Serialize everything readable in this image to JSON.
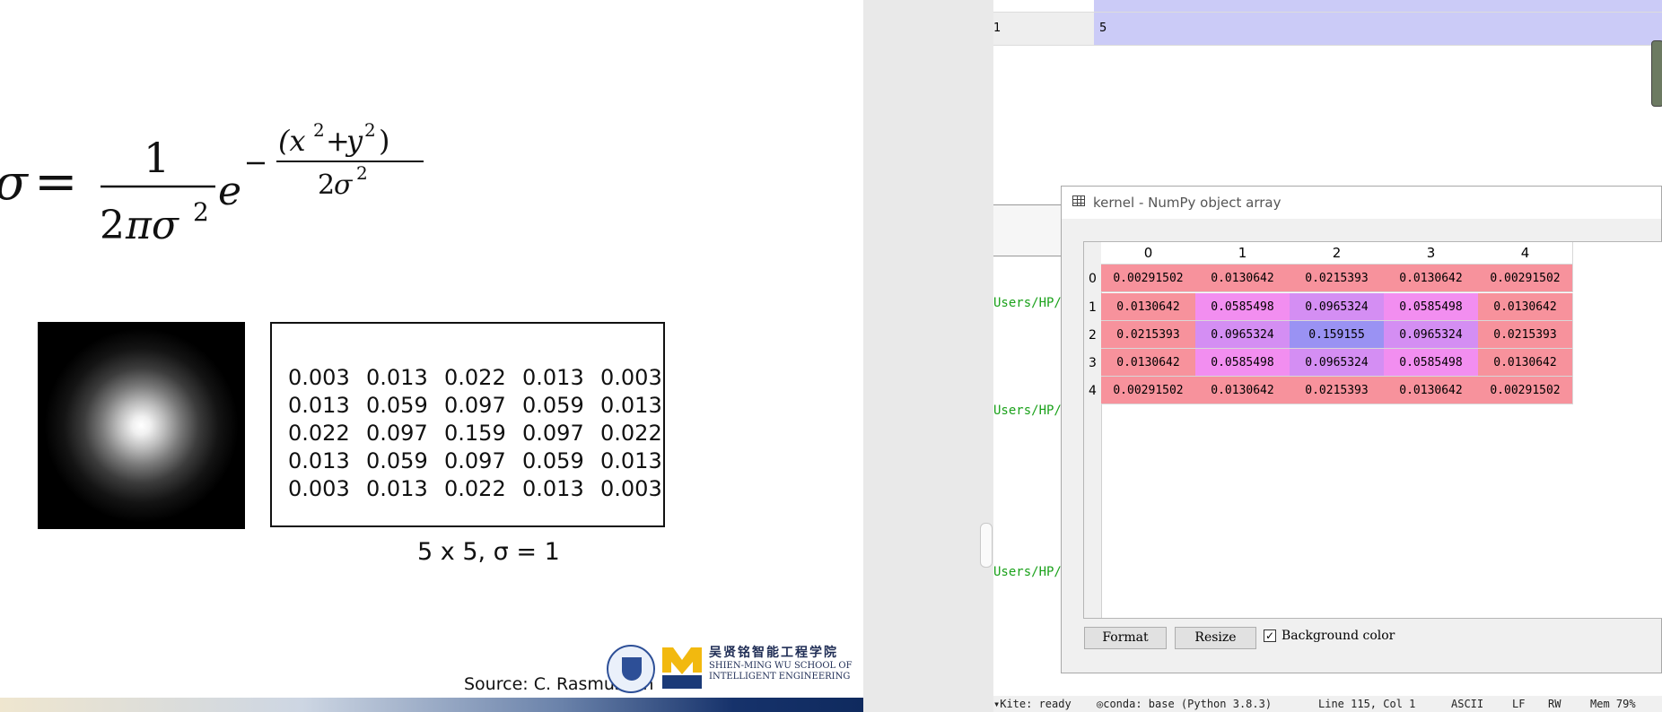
{
  "slide": {
    "kernel_values": [
      [
        "0.003",
        "0.013",
        "0.022",
        "0.013",
        "0.003"
      ],
      [
        "0.013",
        "0.059",
        "0.097",
        "0.059",
        "0.013"
      ],
      [
        "0.022",
        "0.097",
        "0.159",
        "0.097",
        "0.022"
      ],
      [
        "0.013",
        "0.059",
        "0.097",
        "0.059",
        "0.013"
      ],
      [
        "0.003",
        "0.013",
        "0.022",
        "0.013",
        "0.003"
      ]
    ],
    "caption": "5 x 5, σ = 1",
    "source": "Source: C. Rasmussen",
    "school_cn": "吴贤铭智能工程学院",
    "school_en_1": "SHIEN-MING WU SCHOOL OF",
    "school_en_2": "INTELLIGENT ENGINEERING"
  },
  "ide": {
    "var_row": {
      "index": "1",
      "value": "5"
    },
    "paths": [
      "Users/HP/",
      "Users/HP/",
      "Users/HP/"
    ],
    "status": {
      "kite": "Kite: ready",
      "conda": "conda: base (Python 3.8.3)",
      "cursor": "Line 115, Col 1",
      "encoding": "ASCII",
      "eol": "LF",
      "mode": "RW",
      "mem": "Mem 79%"
    }
  },
  "array_editor": {
    "title": "kernel - NumPy object array",
    "columns": [
      "0",
      "1",
      "2",
      "3",
      "4"
    ],
    "rows": [
      "0",
      "1",
      "2",
      "3",
      "4"
    ],
    "cells": [
      [
        "0.00291502",
        "0.0130642",
        "0.0215393",
        "0.0130642",
        "0.00291502"
      ],
      [
        "0.0130642",
        "0.0585498",
        "0.0965324",
        "0.0585498",
        "0.0130642"
      ],
      [
        "0.0215393",
        "0.0965324",
        "0.159155",
        "0.0965324",
        "0.0215393"
      ],
      [
        "0.0130642",
        "0.0585498",
        "0.0965324",
        "0.0585498",
        "0.0130642"
      ],
      [
        "0.00291502",
        "0.0130642",
        "0.0215393",
        "0.0130642",
        "0.00291502"
      ]
    ],
    "format_button": "Format",
    "resize_button": "Resize",
    "bg_color_label": "Background color",
    "bg_color_checked": true
  },
  "colors": {
    "low": "#f7929c",
    "mid": "#f28ef0",
    "midhigh": "#d48ef3",
    "high": "#9a92f3"
  }
}
